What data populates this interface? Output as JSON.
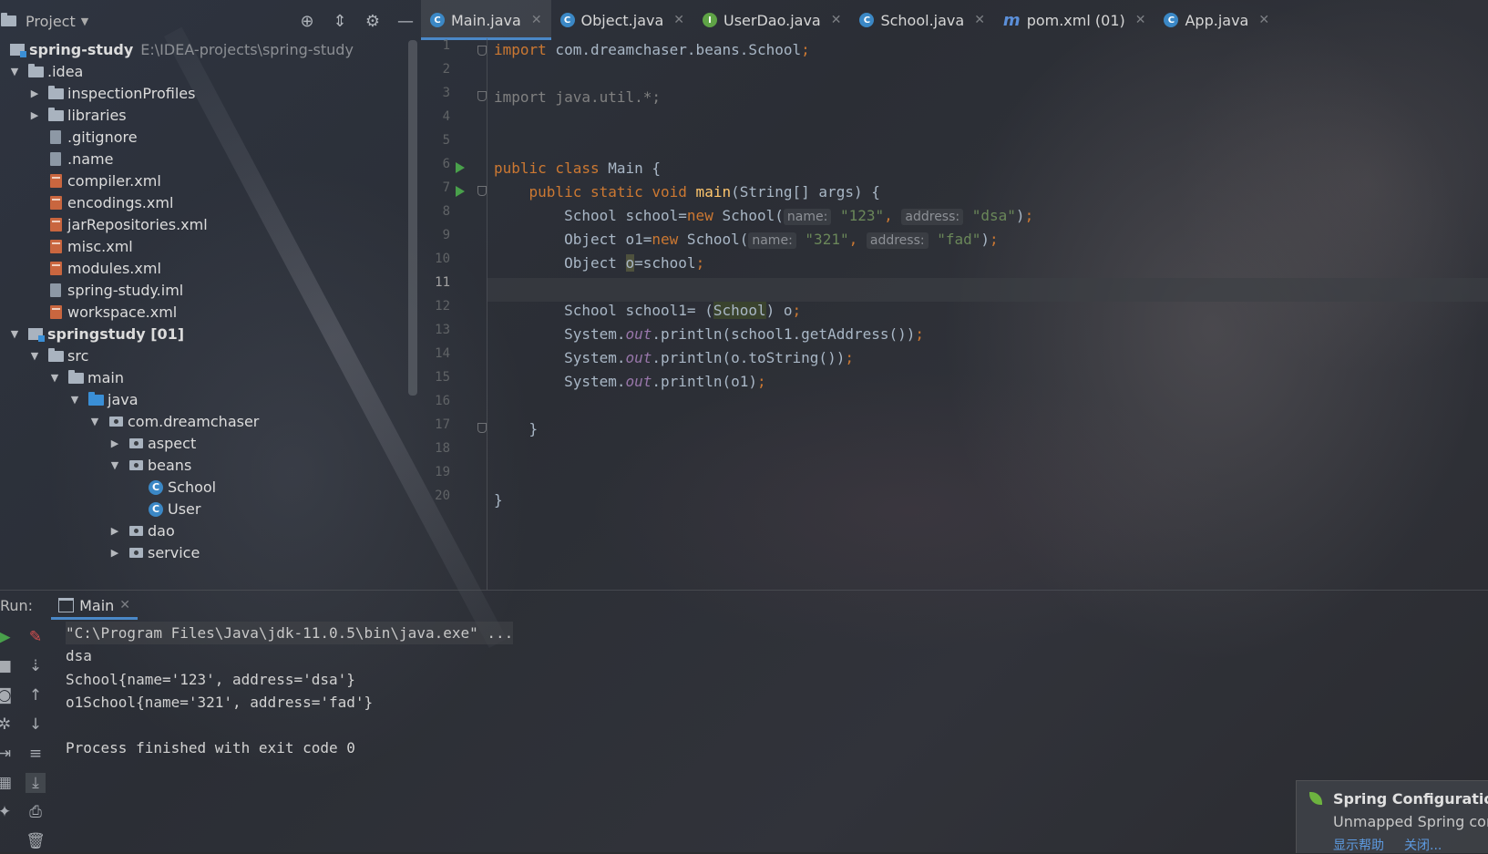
{
  "project": {
    "title": "Project",
    "root_name": "spring-study",
    "root_path": "E:\\IDEA-projects\\spring-study",
    "tree": [
      {
        "label": ".idea",
        "type": "folder",
        "expanded": true
      },
      {
        "label": "inspectionProfiles",
        "type": "folder"
      },
      {
        "label": "libraries",
        "type": "folder"
      },
      {
        "label": ".gitignore",
        "type": "file"
      },
      {
        "label": ".name",
        "type": "file"
      },
      {
        "label": "compiler.xml",
        "type": "xml"
      },
      {
        "label": "encodings.xml",
        "type": "xml"
      },
      {
        "label": "jarRepositories.xml",
        "type": "xml"
      },
      {
        "label": "misc.xml",
        "type": "xml"
      },
      {
        "label": "modules.xml",
        "type": "xml"
      },
      {
        "label": "spring-study.iml",
        "type": "file"
      },
      {
        "label": "workspace.xml",
        "type": "xml"
      },
      {
        "label": "springstudy [01]",
        "type": "module"
      },
      {
        "label": "src",
        "type": "folder"
      },
      {
        "label": "main",
        "type": "folder"
      },
      {
        "label": "java",
        "type": "folder-blue"
      },
      {
        "label": "com.dreamchaser",
        "type": "package"
      },
      {
        "label": "aspect",
        "type": "package"
      },
      {
        "label": "beans",
        "type": "package"
      },
      {
        "label": "School",
        "type": "class"
      },
      {
        "label": "User",
        "type": "class"
      },
      {
        "label": "dao",
        "type": "package"
      },
      {
        "label": "service",
        "type": "package"
      }
    ]
  },
  "tabs": [
    {
      "label": "Main.java",
      "icon": "java-class-icon",
      "active": true
    },
    {
      "label": "Object.java",
      "icon": "java-class-icon"
    },
    {
      "label": "UserDao.java",
      "icon": "java-interface-icon"
    },
    {
      "label": "School.java",
      "icon": "java-class-icon"
    },
    {
      "label": "pom.xml (01)",
      "icon": "maven-icon"
    },
    {
      "label": "App.java",
      "icon": "java-class-icon"
    }
  ],
  "editor": {
    "line_numbers": [
      "1",
      "2",
      "3",
      "4",
      "5",
      "6",
      "7",
      "8",
      "9",
      "10",
      "11",
      "12",
      "13",
      "14",
      "15",
      "16",
      "17",
      "18",
      "19",
      "20"
    ],
    "current_line": "11",
    "code": {
      "l1_kw": "import",
      "l1_rest": " com.dreamchaser.beans.School",
      "l3": "import java.util.*;",
      "l6_kw": "public class",
      "l6_rest": " Main {",
      "l7_kw": "    public static void",
      "l7_fn": " main",
      "l7_rest": "(String[] args) {",
      "l8_a": "        School school=",
      "l8_new": "new",
      "l8_b": " School(",
      "hint_name": "name:",
      "hint_address": "address:",
      "l8_s1": "\"123\"",
      "l8_s2": "\"dsa\"",
      "l9_a": "        Object o1=",
      "l9_b": " School(",
      "l9_s1": "\"321\"",
      "l9_s2": "\"fad\"",
      "l10_a": "        Object ",
      "l10_o": "o",
      "l10_b": "=school",
      "l12_a": "        School school1= (",
      "l12_cls": "School",
      "l12_b": ") o",
      "sys": "        System.",
      "out": "out",
      "l13_rest": ".println(school1.getAddress())",
      "l14_rest": ".println(o.toString())",
      "l15_rest": ".println(o1)",
      "l17": "    }",
      "l20": "}"
    }
  },
  "run": {
    "label": "Run:",
    "tab": "Main",
    "output": [
      "\"C:\\Program Files\\Java\\jdk-11.0.5\\bin\\java.exe\" ...",
      "dsa",
      "School{name='123', address='dsa'}",
      "o1School{name='321', address='fad'}",
      "",
      "Process finished with exit code 0"
    ]
  },
  "notification": {
    "title": "Spring Configuration C",
    "body": "Unmapped Spring confi",
    "link1": "显示帮助",
    "link2": "关闭..."
  }
}
